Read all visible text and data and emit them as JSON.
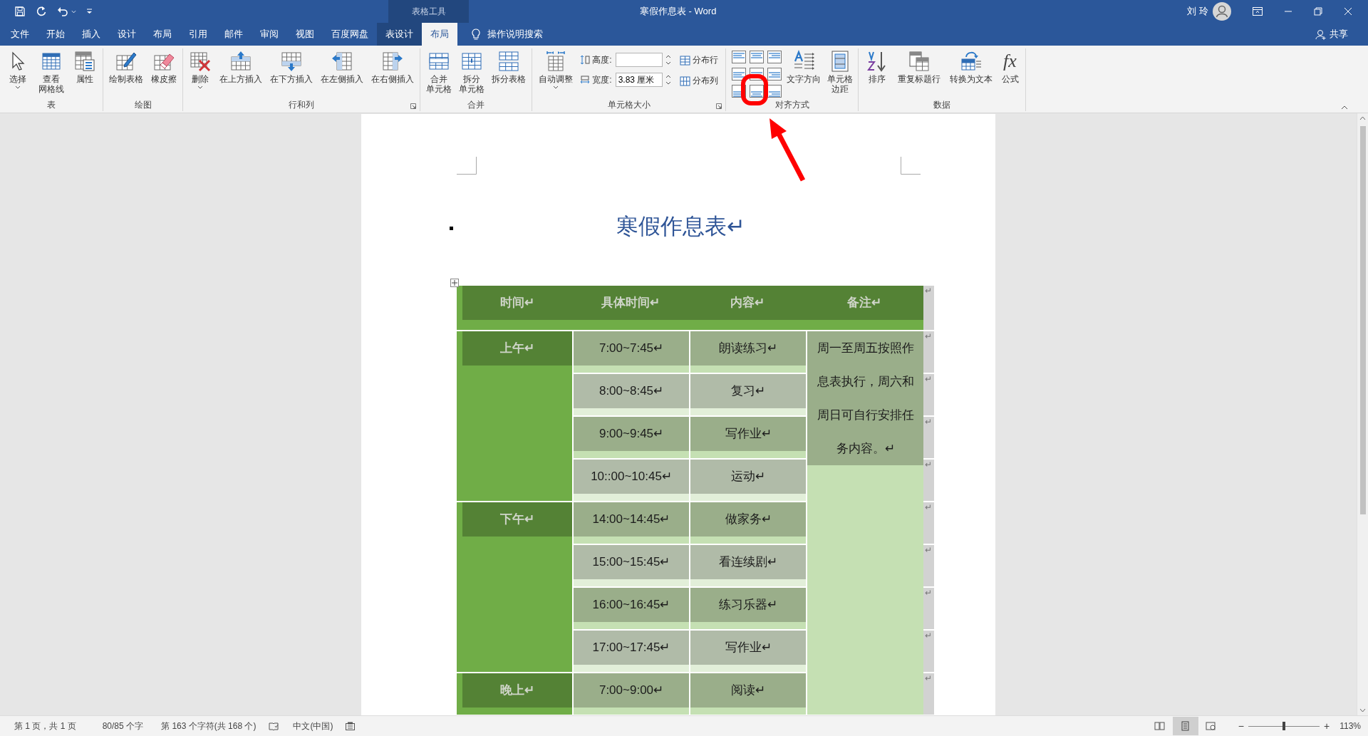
{
  "window": {
    "title": "寒假作息表 - Word",
    "context_label": "表格工具",
    "user": "刘 玲"
  },
  "tabs": [
    {
      "label": "文件",
      "kind": "normal",
      "selected": false
    },
    {
      "label": "开始",
      "kind": "normal",
      "selected": false
    },
    {
      "label": "插入",
      "kind": "normal",
      "selected": false
    },
    {
      "label": "设计",
      "kind": "normal",
      "selected": false
    },
    {
      "label": "布局",
      "kind": "normal",
      "selected": false
    },
    {
      "label": "引用",
      "kind": "normal",
      "selected": false
    },
    {
      "label": "邮件",
      "kind": "normal",
      "selected": false
    },
    {
      "label": "审阅",
      "kind": "normal",
      "selected": false
    },
    {
      "label": "视图",
      "kind": "normal",
      "selected": false
    },
    {
      "label": "百度网盘",
      "kind": "normal",
      "selected": false
    },
    {
      "label": "表设计",
      "kind": "context",
      "selected": false
    },
    {
      "label": "布局",
      "kind": "context",
      "selected": true
    }
  ],
  "tell_me": "操作说明搜索",
  "share": "共享",
  "ribbon": [
    {
      "label": "表",
      "items": [
        {
          "kind": "large",
          "label": "选择",
          "dropdown": true
        },
        {
          "kind": "large",
          "label_lines": [
            "查看",
            "网格线"
          ]
        },
        {
          "kind": "large",
          "label": "属性"
        }
      ]
    },
    {
      "label": "绘图",
      "items": [
        {
          "kind": "large",
          "label": "绘制表格"
        },
        {
          "kind": "large",
          "label": "橡皮擦"
        }
      ]
    },
    {
      "label": "行和列",
      "launcher": true,
      "items": [
        {
          "kind": "large",
          "label": "删除",
          "dropdown": true
        },
        {
          "kind": "large",
          "label": "在上方插入"
        },
        {
          "kind": "large",
          "label": "在下方插入"
        },
        {
          "kind": "large",
          "label": "在左侧插入"
        },
        {
          "kind": "large",
          "label": "在右侧插入"
        }
      ]
    },
    {
      "label": "合并",
      "items": [
        {
          "kind": "large",
          "label_lines": [
            "合并",
            "单元格"
          ]
        },
        {
          "kind": "large",
          "label_lines": [
            "拆分",
            "单元格"
          ]
        },
        {
          "kind": "large",
          "label": "拆分表格"
        }
      ]
    },
    {
      "label": "单元格大小",
      "launcher": true,
      "items": [
        {
          "kind": "large",
          "label": "自动调整",
          "dropdown": true
        },
        {
          "kind": "stack",
          "items": [
            {
              "kind": "spin",
              "label": "高度:"
            },
            {
              "kind": "spin",
              "label": "宽度:",
              "value": "3.83 厘米"
            }
          ]
        },
        {
          "kind": "stack",
          "items": [
            {
              "kind": "small",
              "label": "分布行"
            },
            {
              "kind": "small",
              "label": "分布列"
            }
          ]
        }
      ]
    },
    {
      "label": "对齐方式",
      "items": [
        {
          "kind": "align-grid"
        },
        {
          "kind": "large",
          "label": "文字方向"
        },
        {
          "kind": "large",
          "label_lines": [
            "单元格",
            "边距"
          ]
        }
      ]
    },
    {
      "label": "数据",
      "items": [
        {
          "kind": "large",
          "label": "排序"
        },
        {
          "kind": "large",
          "label": "重复标题行"
        },
        {
          "kind": "large",
          "label": "转换为文本"
        },
        {
          "kind": "large",
          "label": "公式",
          "glyph": "fx"
        }
      ]
    }
  ],
  "document": {
    "title": "寒假作息表↵",
    "table": {
      "columns": [
        "时间↵",
        "具体时间↵",
        "内容↵",
        "备注↵"
      ],
      "periods": [
        {
          "label": "上午↵",
          "rows": [
            {
              "time": "7:00~7:45↵",
              "content": "朗读练习↵"
            },
            {
              "time": "8:00~8:45↵",
              "content": "复习↵"
            },
            {
              "time": "9:00~9:45↵",
              "content": "写作业↵"
            },
            {
              "time": "10::00~10:45↵",
              "content": "运动↵"
            }
          ]
        },
        {
          "label": "下午↵",
          "rows": [
            {
              "time": "14:00~14:45↵",
              "content": "做家务↵"
            },
            {
              "time": "15:00~15:45↵",
              "content": "看连续剧↵"
            },
            {
              "time": "16:00~16:45↵",
              "content": "练习乐器↵"
            },
            {
              "time": "17:00~17:45↵",
              "content": "写作业↵"
            }
          ]
        },
        {
          "label": "晚上↵",
          "rows": [
            {
              "time": "7:00~9:00↵",
              "content": "阅读↵"
            }
          ]
        }
      ],
      "note": "周一至周五按照作息表执行，周六和周日可自行安排任务内容。↵",
      "row_end_marks": [
        "↵",
        "↵",
        "↵",
        "↵",
        "↵",
        "↵",
        "↵",
        "↵",
        "↵",
        "↵"
      ]
    }
  },
  "status_bar": {
    "items": [
      "第 1 页，共 1 页",
      "80/85 个字",
      "第 163 个字符(共 168 个)",
      "中文(中国)"
    ],
    "views": [
      {
        "selected": false
      },
      {
        "selected": true
      },
      {
        "selected": false
      }
    ],
    "zoom_out": "−",
    "zoom_slider": {
      "level": 0.5
    },
    "zoom_in": "+",
    "zoom": "113%"
  }
}
